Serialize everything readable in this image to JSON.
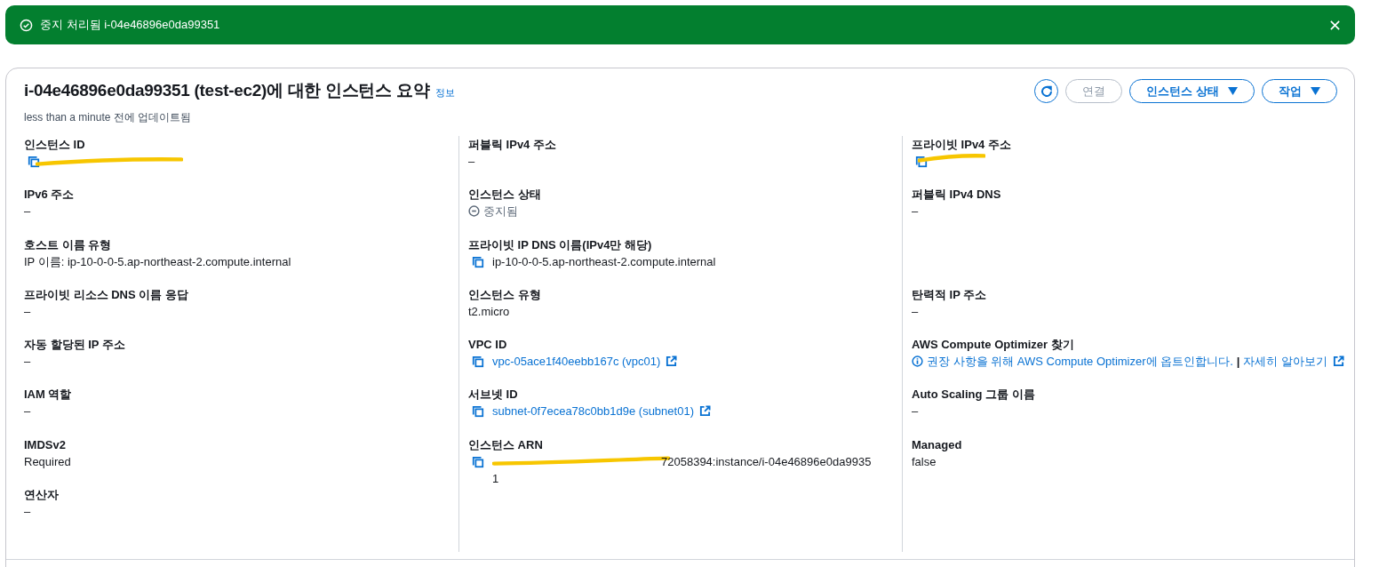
{
  "flash": {
    "message": "중지 처리됨 i-04e46896e0da99351",
    "dismissible": true
  },
  "summary": {
    "title": "i-04e46896e0da99351 (test-ec2)에 대한 인스턴스 요약",
    "info_link": "정보",
    "updated": "less than a minute 전에 업데이트됨",
    "buttons": [
      {
        "kind": "refresh",
        "disabled": false
      },
      {
        "kind": "plain",
        "label": "연결",
        "disabled": true
      },
      {
        "kind": "dropdown",
        "label": "인스턴스 상태",
        "disabled": false
      },
      {
        "kind": "dropdown",
        "label": "작업",
        "disabled": false
      }
    ],
    "columns": [
      [
        [
          {
            "label": "인스턴스 ID",
            "kind": "redacted"
          },
          {
            "label": "IPv6 주소",
            "kind": "text",
            "value": "–"
          },
          {
            "label": "호스트 이름 유형",
            "kind": "text",
            "value": "IP 이름: ip-10-0-0-5.ap-northeast-2.compute.internal"
          },
          {
            "label": "프라이빗 리소스 DNS 이름 응답",
            "kind": "text",
            "value": "–"
          },
          {
            "label": "자동 할당된 IP 주소",
            "kind": "text",
            "value": "–"
          },
          {
            "label": "IAM 역할",
            "kind": "text",
            "value": "–"
          },
          {
            "label": "IMDSv2",
            "kind": "text",
            "value": "Required"
          },
          {
            "label": "연산자",
            "kind": "text",
            "value": "–"
          }
        ]
      ],
      [
        [
          {
            "label": "퍼블릭 IPv4 주소",
            "kind": "text",
            "value": "–"
          },
          {
            "label": "인스턴스 상태",
            "kind": "status",
            "value": "중지됨"
          },
          {
            "label": "프라이빗 IP DNS 이름(IPv4만 해당)",
            "kind": "copy",
            "value": "ip-10-0-0-5.ap-northeast-2.compute.internal"
          },
          {
            "label": "인스턴스 유형",
            "kind": "text",
            "value": "t2.micro"
          },
          {
            "label": "VPC ID",
            "kind": "link",
            "value": "vpc-05ace1f40eebb167c (vpc01)"
          },
          {
            "label": "서브넷 ID",
            "kind": "link",
            "value": "subnet-0f7ecea78c0bb1d9e (subnet01)"
          },
          {
            "label": "인스턴스 ARN",
            "kind": "arn",
            "value": "72058394:instance/i-04e46896e0da9935",
            "value_2": "1"
          }
        ]
      ],
      [
        [
          {
            "label": "프라이빗 IPv4 주소",
            "kind": "redacted"
          },
          {
            "label": "퍼블릭 IPv4 DNS",
            "kind": "text",
            "value": "–"
          }
        ],
        [
          {
            "label": "탄력적 IP 주소",
            "kind": "text",
            "value": "–"
          },
          {
            "label": "AWS Compute Optimizer 찾기",
            "kind": "info",
            "value": "권장 사항을 위해 AWS Compute Optimizer에 옵트인합니다.",
            "separator": "|",
            "link": "자세히 알아보기"
          },
          {
            "label": "Auto Scaling 그룹 이름",
            "kind": "text",
            "value": "–"
          },
          {
            "label": "Managed",
            "kind": "text",
            "value": "false"
          }
        ]
      ]
    ]
  }
}
